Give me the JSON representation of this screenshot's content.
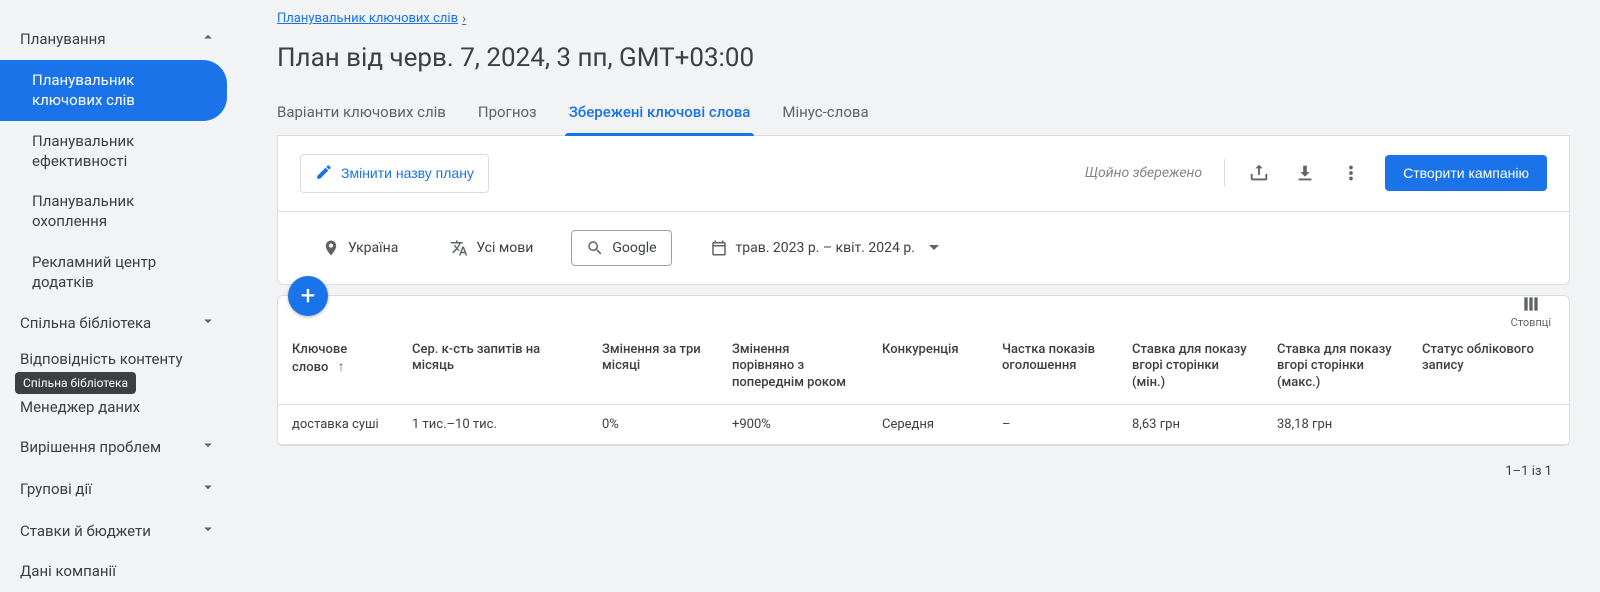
{
  "sidebar": {
    "sections": {
      "planning_label": "Планування",
      "shared_label": "Спільна бібліотека",
      "content_label": "Відповідність контенту",
      "data_mgr_label": "Менеджер даних",
      "troubleshoot_label": "Вирішення проблем",
      "bulk_label": "Групові дії",
      "bids_label": "Ставки й бюджети",
      "company_label": "Дані компанії"
    },
    "planning_items": [
      "Планувальник ключових слів",
      "Планувальник ефективності",
      "Планувальник охоплення",
      "Рекламний центр додатків"
    ],
    "tooltip": "Спільна бібліотека"
  },
  "breadcrumb": "Планувальник ключових слів",
  "page_title": "План від черв. 7, 2024, 3 пп, GMT+03:00",
  "tabs": [
    "Варіанти ключових слів",
    "Прогноз",
    "Збережені ключові слова",
    "Мінус-слова"
  ],
  "active_tab_index": 2,
  "toolbar": {
    "rename": "Змінити назву плану",
    "saved_status": "Щойно збережено",
    "create_campaign": "Створити кампанію"
  },
  "filters": {
    "location": "Україна",
    "language": "Усі мови",
    "network": "Google",
    "date_range": "трав. 2023 р. – квіт. 2024 р."
  },
  "columns_label": "Стовпці",
  "headers": {
    "keyword": "Ключове слово",
    "avg_month": "Сер. к-сть запитів на місяць",
    "change_3m": "Змінення за три місяці",
    "change_yoy": "Змінення порівняно з попереднім роком",
    "competition": "Конкуренція",
    "impr_share": "Частка показів оголошення",
    "bid_low": "Ставка для показу вгорі сторінки (мін.)",
    "bid_high": "Ставка для показу вгорі сторінки (макс.)",
    "account_status": "Статус облікового запису"
  },
  "rows": [
    {
      "keyword": "доставка суші",
      "avg_month": "1 тис.–10 тис.",
      "change_3m": "0%",
      "change_yoy": "+900%",
      "competition": "Середня",
      "impr_share": "–",
      "bid_low": "8,63 грн",
      "bid_high": "38,18 грн",
      "account_status": ""
    }
  ],
  "pagination": "1–1 із 1"
}
